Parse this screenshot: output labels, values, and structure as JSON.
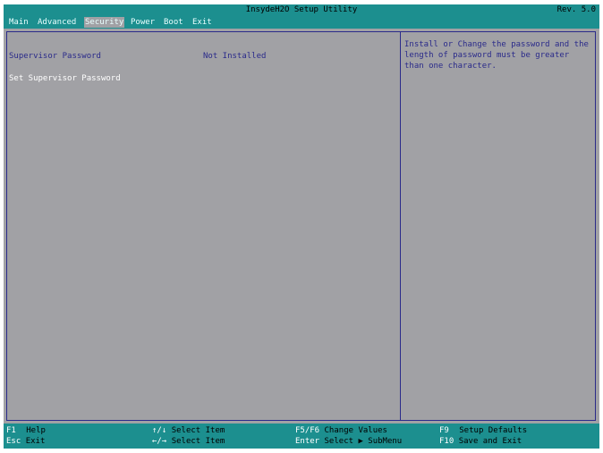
{
  "window": {
    "title": "InsydeH2O Setup Utility",
    "revision": "Rev. 5.0"
  },
  "menu": {
    "items": [
      "Main",
      "Advanced",
      "Security",
      "Power",
      "Boot",
      "Exit"
    ],
    "active": "Security"
  },
  "settings": {
    "supervisor_password": {
      "label": "Supervisor Password",
      "value": "Not Installed"
    },
    "set_supervisor_password": {
      "label": "Set Supervisor Password"
    }
  },
  "help_text": "Install or Change the password and the length of password  must be greater than one character.",
  "footer": {
    "hints": [
      {
        "key": "F1",
        "desc": "Help"
      },
      {
        "key": "Esc",
        "desc": "Exit"
      },
      {
        "key": "↑/↓",
        "desc": "Select Item"
      },
      {
        "key": "←/→",
        "desc": "Select Item"
      },
      {
        "key": "F5/F6",
        "desc": "Change Values"
      },
      {
        "key": "Enter",
        "desc": "Select ▶ SubMenu"
      },
      {
        "key": "F9",
        "desc": "Setup Defaults"
      },
      {
        "key": "F10",
        "desc": "Save and Exit"
      }
    ]
  },
  "colors": {
    "bar": "#1c8f8f",
    "panel": "#a1a1a5",
    "text": "#2a2a8a",
    "highlight": "#ffffff"
  }
}
